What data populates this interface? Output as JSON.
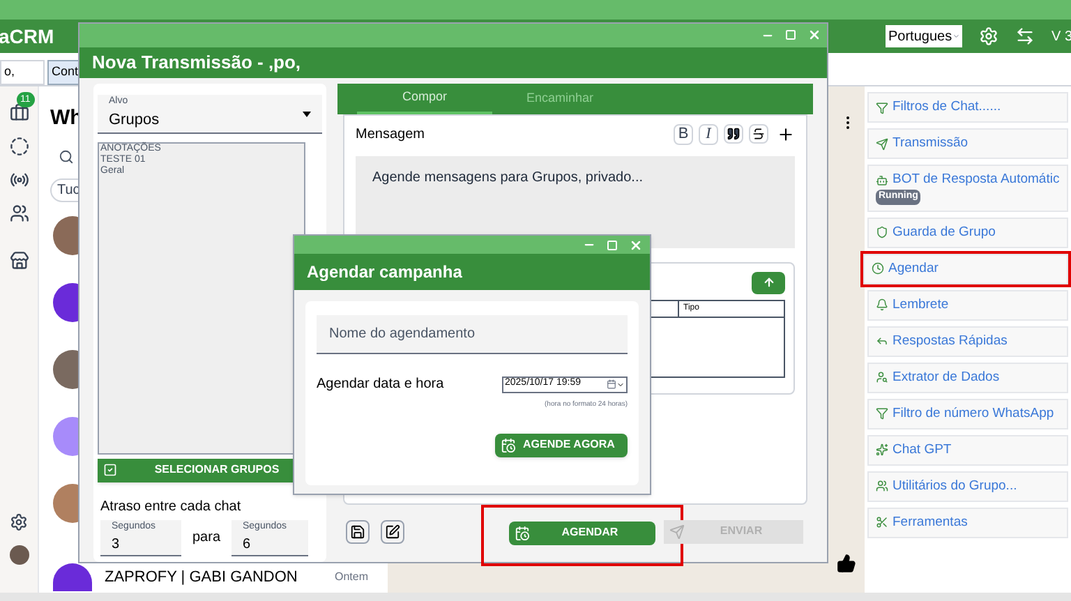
{
  "app": {
    "title": "aCRM",
    "language": "Portugues",
    "version": "V 3"
  },
  "tabs": [
    {
      "label": "o,",
      "selected": true
    },
    {
      "label": "Cont",
      "selected": false
    }
  ],
  "rail": {
    "badge": "11"
  },
  "chat_list": {
    "title": "Wh",
    "filter_chip": "Tuc",
    "last_chat": {
      "name": "ZAPROFY | GABI GANDON",
      "time": "Ontem"
    }
  },
  "sidebar": {
    "items": [
      {
        "label": "Filtros de Chat......",
        "highlighted": false
      },
      {
        "label": "Transmissão",
        "highlighted": false
      },
      {
        "label": "BOT de Resposta Automátic",
        "badge": "Running",
        "highlighted": false
      },
      {
        "label": "Guarda de Grupo",
        "highlighted": false
      },
      {
        "label": "Agendar",
        "highlighted": true
      },
      {
        "label": "Lembrete",
        "highlighted": false
      },
      {
        "label": "Respostas Rápidas",
        "highlighted": false
      },
      {
        "label": "Extrator de Dados",
        "highlighted": false
      },
      {
        "label": "Filtro de número WhatsApp",
        "highlighted": false
      },
      {
        "label": "Chat GPT",
        "highlighted": false
      },
      {
        "label": "Utilitários do Grupo...",
        "highlighted": false
      },
      {
        "label": "Ferramentas",
        "highlighted": false
      }
    ]
  },
  "broadcast_dialog": {
    "title": "Nova Transmissão - ,po,",
    "target": {
      "label": "Alvo",
      "value": "Grupos"
    },
    "groups": [
      "ANOTAÇÕES",
      "TESTE 01",
      "Geral"
    ],
    "select_button": "SELECIONAR GRUPOS",
    "delay": {
      "label": "Atraso entre cada chat",
      "from": {
        "label": "Segundos",
        "value": "3"
      },
      "separator": "para",
      "to": {
        "label": "Segundos",
        "value": "6"
      }
    },
    "tabs": [
      {
        "label": "Compor",
        "selected": true
      },
      {
        "label": "Encaminhar",
        "selected": false
      }
    ],
    "message": {
      "label": "Mensagem",
      "format_buttons": [
        "B",
        "I"
      ],
      "value": "Agende mensagens para Grupos, privado..."
    },
    "attachments": {
      "columns": [
        "Tipo"
      ]
    },
    "schedule_button": {
      "label": "AGENDAR",
      "highlighted": true
    },
    "send_button": {
      "label": "ENVIAR",
      "disabled": true
    }
  },
  "schedule_dialog": {
    "title": "Agendar campanha",
    "name_field": {
      "placeholder": "Nome do agendamento"
    },
    "datetime": {
      "label": "Agendar data e hora",
      "value": "2025/10/17 19:59",
      "hint": "(hora no formato 24 horas)"
    },
    "button": "AGENDE AGORA"
  }
}
